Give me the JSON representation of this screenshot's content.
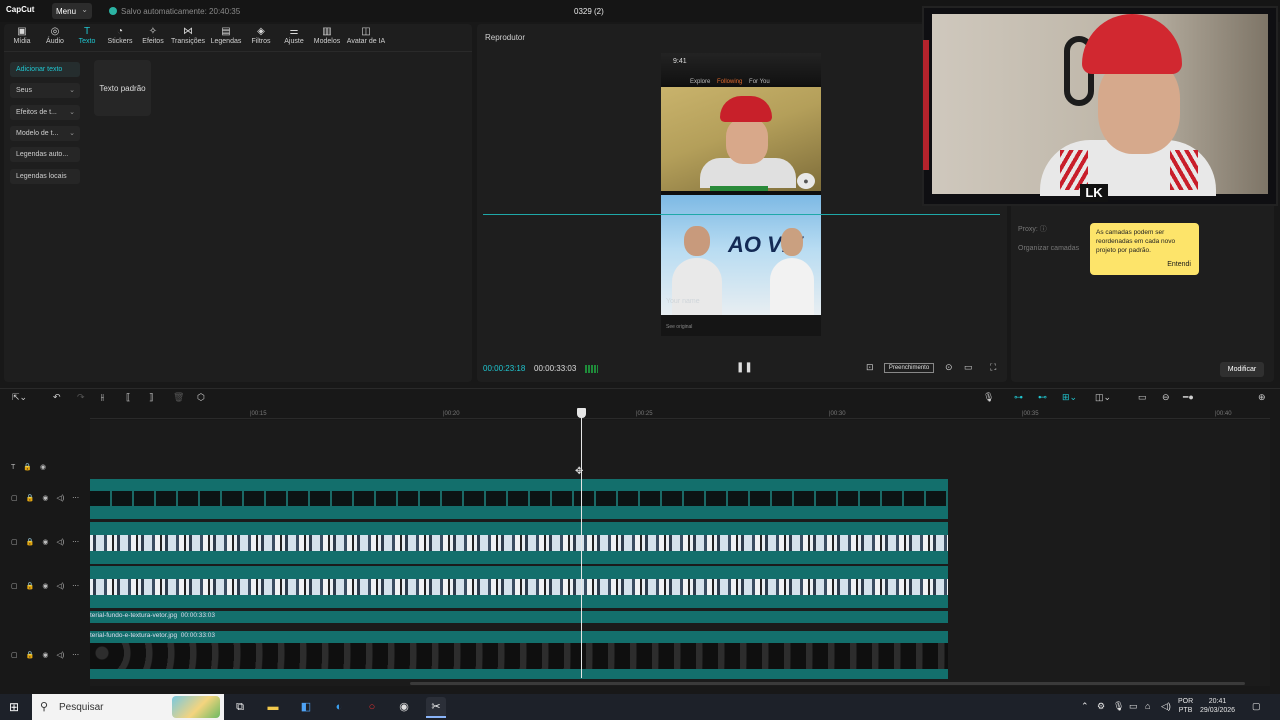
{
  "app": {
    "logo": "CapCut",
    "menu_label": "Menu",
    "autosave": "Salvo automaticamente: 20:40:35",
    "project_title": "0329 (2)"
  },
  "toolbar": {
    "items": [
      {
        "label": "Mídia",
        "icon": "media-icon"
      },
      {
        "label": "Áudio",
        "icon": "audio-icon"
      },
      {
        "label": "Texto",
        "icon": "text-icon"
      },
      {
        "label": "Stickers",
        "icon": "sticker-icon"
      },
      {
        "label": "Efeitos",
        "icon": "effects-icon"
      },
      {
        "label": "Transições",
        "icon": "transitions-icon"
      },
      {
        "label": "Legendas",
        "icon": "captions-icon"
      },
      {
        "label": "Filtros",
        "icon": "filters-icon"
      },
      {
        "label": "Ajuste",
        "icon": "adjust-icon"
      },
      {
        "label": "Modelos",
        "icon": "templates-icon"
      },
      {
        "label": "Avatar de IA",
        "icon": "ai-avatar-icon"
      }
    ],
    "active": "Texto"
  },
  "sidebar": {
    "items": [
      {
        "label": "Adicionar texto",
        "dropdown": false
      },
      {
        "label": "Seus",
        "dropdown": true
      },
      {
        "label": "Efeitos de t...",
        "dropdown": true
      },
      {
        "label": "Modelo de t...",
        "dropdown": true
      },
      {
        "label": "Legendas auto...",
        "dropdown": false
      },
      {
        "label": "Legendas locais",
        "dropdown": false
      }
    ]
  },
  "text_panel": {
    "default_card": "Texto padrão"
  },
  "player": {
    "title": "Reprodutor",
    "current_time": "00:00:23:18",
    "total_time": "00:00:33:03",
    "fill_mode": "Preenchimento",
    "phone_time": "9:41",
    "tabs": [
      "Explore",
      "Following",
      "For You"
    ],
    "banner_text": "AO VIV",
    "your_name": "Your name",
    "see_original": "See original"
  },
  "right_panel": {
    "proxy_label": "Proxy:",
    "organize_label": "Organizar camadas",
    "tooltip_text": "As camadas podem ser reordenadas em cada novo projeto por padrão.",
    "tooltip_ok": "Entendi",
    "modify_button": "Modificar"
  },
  "webcam": {
    "badge": "LK"
  },
  "timeline": {
    "ruler": [
      "|00:15",
      "|00:20",
      "|00:25",
      "|00:30",
      "|00:35",
      "|00:40"
    ],
    "clips": [
      {
        "name": "terial-fundo-e-textura-vetor.jpg",
        "duration": "00:00:33:03"
      },
      {
        "name": "terial-fundo-e-textura-vetor.jpg",
        "duration": "00:00:33:03"
      }
    ]
  },
  "taskbar": {
    "search_placeholder": "Pesquisar",
    "language": "POR",
    "layout": "PTB",
    "time": "20:41",
    "date": "29/03/2026"
  }
}
